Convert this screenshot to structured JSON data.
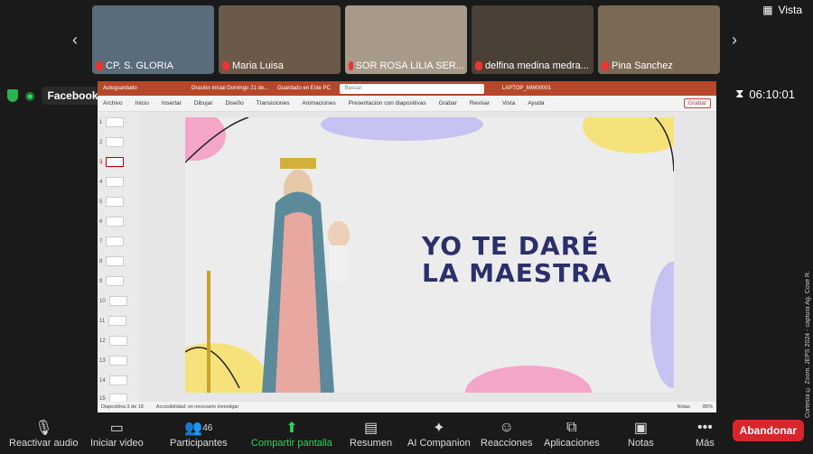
{
  "view_label": "Vista",
  "participants_thumbs": [
    {
      "name": "CP. S. GLORIA"
    },
    {
      "name": "Maria Luisa"
    },
    {
      "name": "SOR ROSA LILIA SER..."
    },
    {
      "name": "delfina medina medra..."
    },
    {
      "name": "Pina Sanchez"
    }
  ],
  "stream_label": "Facebook",
  "timer": "06:10:01",
  "ppt": {
    "autosave": "Autoguardado",
    "doc_title": "Oración Inicial Domingo 21 de...",
    "saved": "Guardado en Este PC",
    "search_placeholder": "Buscar",
    "user": "LAPTOP_MW00001",
    "menu": [
      "Archivo",
      "Inicio",
      "Insertar",
      "Dibujar",
      "Diseño",
      "Transiciones",
      "Animaciones",
      "Presentación con diapositivas",
      "Grabar",
      "Revisar",
      "Vista",
      "Ayuda"
    ],
    "record_btn": "Grabar",
    "slide_numbers": [
      "1",
      "2",
      "3",
      "4",
      "5",
      "6",
      "7",
      "8",
      "9",
      "10",
      "11",
      "12",
      "13",
      "14",
      "15"
    ],
    "slide_title_line1": "YO TE DARÉ",
    "slide_title_line2": "LA MAESTRA",
    "status_slide": "Diapositiva 3 de 18",
    "accessibility": "Accesibilidad: es necesario investigar",
    "notes": "Notas",
    "zoom": "85%"
  },
  "toolbar": {
    "audio": "Reactivar audio",
    "video": "Iniciar video",
    "participants_count": "46",
    "participants": "Participantes",
    "share": "Compartir pantalla",
    "summary": "Resumen",
    "ai": "AI Companion",
    "reactions": "Reacciones",
    "apps": "Aplicaciones",
    "notes": "Notas",
    "more": "Más",
    "leave": "Abandonar"
  },
  "credit": "Cortesía © Zoom. JEPS 2024 - captura Ag. Cose R."
}
